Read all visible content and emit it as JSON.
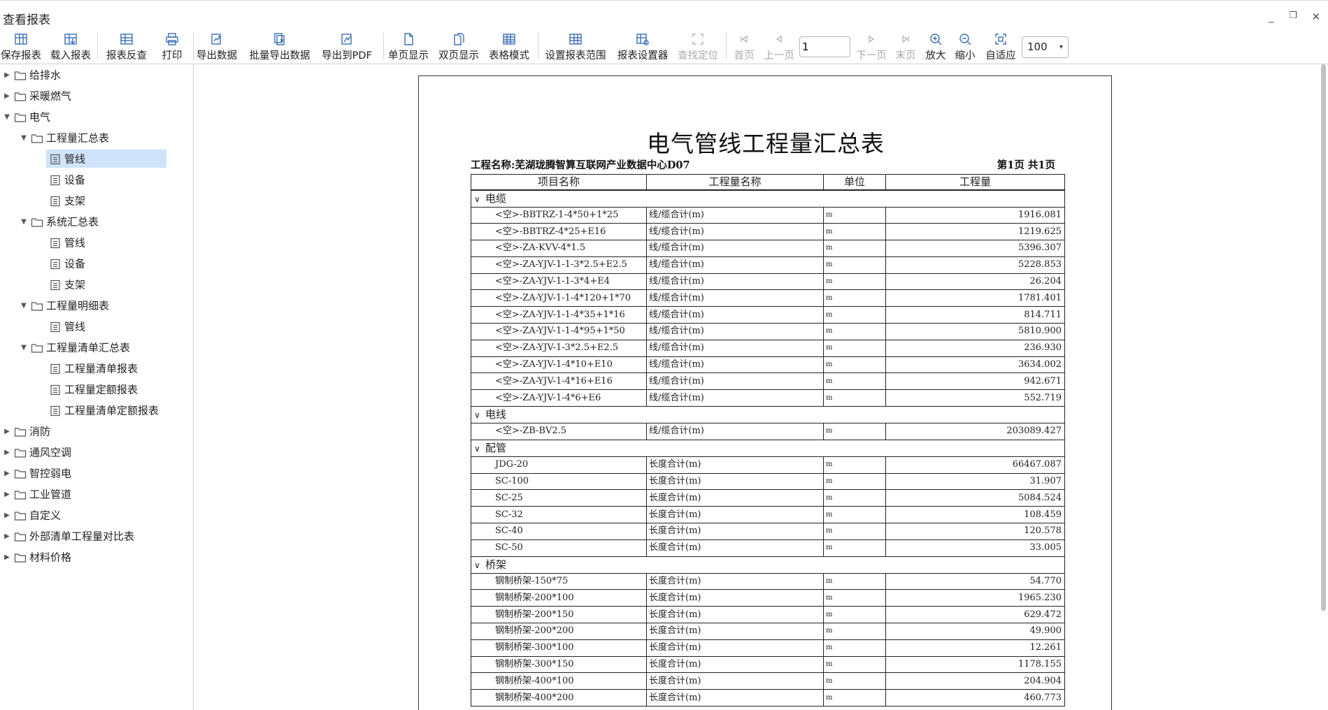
{
  "window": {
    "title": "查看报表",
    "controls": {
      "minimize": "_",
      "restore": "❐",
      "close": "✕"
    }
  },
  "toolbar": {
    "buttons": [
      {
        "label": "保存报表",
        "icon": "save-report-icon",
        "enabled": true
      },
      {
        "label": "载入报表",
        "icon": "load-report-icon",
        "enabled": true
      },
      {
        "label": "报表反查",
        "icon": "report-reverse-lookup-icon",
        "enabled": true
      },
      {
        "label": "打印",
        "icon": "printer-icon",
        "enabled": true
      },
      {
        "label": "导出数据",
        "icon": "export-data-icon",
        "enabled": true
      },
      {
        "label": "批量导出数据",
        "icon": "batch-export-icon",
        "enabled": true
      },
      {
        "label": "导出到PDF",
        "icon": "export-pdf-icon",
        "enabled": true
      },
      {
        "label": "单页显示",
        "icon": "single-page-icon",
        "enabled": true
      },
      {
        "label": "双页显示",
        "icon": "double-page-icon",
        "enabled": true
      },
      {
        "label": "表格模式",
        "icon": "table-mode-icon",
        "enabled": true
      },
      {
        "label": "设置报表范围",
        "icon": "report-range-icon",
        "enabled": true
      },
      {
        "label": "报表设置器",
        "icon": "report-settings-icon",
        "enabled": true
      },
      {
        "label": "查找定位",
        "icon": "locate-icon",
        "enabled": false
      },
      {
        "label": "首页",
        "icon": "first-page-icon",
        "enabled": false
      },
      {
        "label": "上一页",
        "icon": "prev-page-icon",
        "enabled": false
      },
      {
        "label": "下一页",
        "icon": "next-page-icon",
        "enabled": false
      },
      {
        "label": "末页",
        "icon": "last-page-icon",
        "enabled": false
      },
      {
        "label": "放大",
        "icon": "zoom-in-icon",
        "enabled": true
      },
      {
        "label": "缩小",
        "icon": "zoom-out-icon",
        "enabled": true
      },
      {
        "label": "自适应",
        "icon": "fit-icon",
        "enabled": true
      }
    ],
    "page_input_value": "1",
    "zoom_value": "100"
  },
  "tree": [
    {
      "label": "给排水",
      "type": "folder",
      "expanded": false,
      "level": 0
    },
    {
      "label": "采暖燃气",
      "type": "folder",
      "expanded": false,
      "level": 0
    },
    {
      "label": "电气",
      "type": "folder",
      "expanded": true,
      "level": 0
    },
    {
      "label": "工程量汇总表",
      "type": "folder",
      "expanded": true,
      "level": 1
    },
    {
      "label": "管线",
      "type": "report",
      "level": 2,
      "selected": true
    },
    {
      "label": "设备",
      "type": "report",
      "level": 2
    },
    {
      "label": "支架",
      "type": "report",
      "level": 2
    },
    {
      "label": "系统汇总表",
      "type": "folder",
      "expanded": true,
      "level": 1
    },
    {
      "label": "管线",
      "type": "report",
      "level": 2
    },
    {
      "label": "设备",
      "type": "report",
      "level": 2
    },
    {
      "label": "支架",
      "type": "report",
      "level": 2
    },
    {
      "label": "工程量明细表",
      "type": "folder",
      "expanded": true,
      "level": 1
    },
    {
      "label": "管线",
      "type": "report",
      "level": 2
    },
    {
      "label": "工程量清单汇总表",
      "type": "folder",
      "expanded": true,
      "level": 1
    },
    {
      "label": "工程量清单报表",
      "type": "report",
      "level": 2
    },
    {
      "label": "工程量定额报表",
      "type": "report",
      "level": 2
    },
    {
      "label": "工程量清单定额报表",
      "type": "report",
      "level": 2
    },
    {
      "label": "消防",
      "type": "folder",
      "expanded": false,
      "level": 0
    },
    {
      "label": "通风空调",
      "type": "folder",
      "expanded": false,
      "level": 0
    },
    {
      "label": "智控弱电",
      "type": "folder",
      "expanded": false,
      "level": 0
    },
    {
      "label": "工业管道",
      "type": "folder",
      "expanded": false,
      "level": 0
    },
    {
      "label": "自定义",
      "type": "folder",
      "expanded": false,
      "level": 0
    },
    {
      "label": "外部清单工程量对比表",
      "type": "folder",
      "expanded": false,
      "level": 0
    },
    {
      "label": "材料价格",
      "type": "folder",
      "expanded": false,
      "level": 0
    }
  ],
  "report": {
    "title": "电气管线工程量汇总表",
    "project_label": "工程名称:芜湖珑腾智算互联网产业数据中心D07",
    "page_info": "第1页 共1页",
    "columns": [
      "项目名称",
      "工程量名称",
      "单位",
      "工程量"
    ],
    "rows": [
      {
        "group": "电缆"
      },
      {
        "name": "<空>-BBTRZ-1-4*50+1*25",
        "qty_name": "线/缆合计(m)",
        "unit": "m",
        "qty": "1916.081"
      },
      {
        "name": "<空>-BBTRZ-4*25+E16",
        "qty_name": "线/缆合计(m)",
        "unit": "m",
        "qty": "1219.625"
      },
      {
        "name": "<空>-ZA-KVV-4*1.5",
        "qty_name": "线/缆合计(m)",
        "unit": "m",
        "qty": "5396.307"
      },
      {
        "name": "<空>-ZA-YJV-1-1-3*2.5+E2.5",
        "qty_name": "线/缆合计(m)",
        "unit": "m",
        "qty": "5228.853"
      },
      {
        "name": "<空>-ZA-YJV-1-1-3*4+E4",
        "qty_name": "线/缆合计(m)",
        "unit": "m",
        "qty": "26.204"
      },
      {
        "name": "<空>-ZA-YJV-1-1-4*120+1*70",
        "qty_name": "线/缆合计(m)",
        "unit": "m",
        "qty": "1781.401"
      },
      {
        "name": "<空>-ZA-YJV-1-1-4*35+1*16",
        "qty_name": "线/缆合计(m)",
        "unit": "m",
        "qty": "814.711"
      },
      {
        "name": "<空>-ZA-YJV-1-1-4*95+1*50",
        "qty_name": "线/缆合计(m)",
        "unit": "m",
        "qty": "5810.900"
      },
      {
        "name": "<空>-ZA-YJV-1-3*2.5+E2.5",
        "qty_name": "线/缆合计(m)",
        "unit": "m",
        "qty": "236.930"
      },
      {
        "name": "<空>-ZA-YJV-1-4*10+E10",
        "qty_name": "线/缆合计(m)",
        "unit": "m",
        "qty": "3634.002"
      },
      {
        "name": "<空>-ZA-YJV-1-4*16+E16",
        "qty_name": "线/缆合计(m)",
        "unit": "m",
        "qty": "942.671"
      },
      {
        "name": "<空>-ZA-YJV-1-4*6+E6",
        "qty_name": "线/缆合计(m)",
        "unit": "m",
        "qty": "552.719"
      },
      {
        "group": "电线"
      },
      {
        "name": "<空>-ZB-BV2.5",
        "qty_name": "线/缆合计(m)",
        "unit": "m",
        "qty": "203089.427"
      },
      {
        "group": "配管"
      },
      {
        "name": "JDG-20",
        "qty_name": "长度合计(m)",
        "unit": "m",
        "qty": "66467.087"
      },
      {
        "name": "SC-100",
        "qty_name": "长度合计(m)",
        "unit": "m",
        "qty": "31.907"
      },
      {
        "name": "SC-25",
        "qty_name": "长度合计(m)",
        "unit": "m",
        "qty": "5084.524"
      },
      {
        "name": "SC-32",
        "qty_name": "长度合计(m)",
        "unit": "m",
        "qty": "108.459"
      },
      {
        "name": "SC-40",
        "qty_name": "长度合计(m)",
        "unit": "m",
        "qty": "120.578"
      },
      {
        "name": "SC-50",
        "qty_name": "长度合计(m)",
        "unit": "m",
        "qty": "33.005"
      },
      {
        "group": "桥架"
      },
      {
        "name": "钢制桥架-150*75",
        "qty_name": "长度合计(m)",
        "unit": "m",
        "qty": "54.770"
      },
      {
        "name": "钢制桥架-200*100",
        "qty_name": "长度合计(m)",
        "unit": "m",
        "qty": "1965.230"
      },
      {
        "name": "钢制桥架-200*150",
        "qty_name": "长度合计(m)",
        "unit": "m",
        "qty": "629.472"
      },
      {
        "name": "钢制桥架-200*200",
        "qty_name": "长度合计(m)",
        "unit": "m",
        "qty": "49.900"
      },
      {
        "name": "钢制桥架-300*100",
        "qty_name": "长度合计(m)",
        "unit": "m",
        "qty": "12.261"
      },
      {
        "name": "钢制桥架-300*150",
        "qty_name": "长度合计(m)",
        "unit": "m",
        "qty": "1178.155"
      },
      {
        "name": "钢制桥架-400*100",
        "qty_name": "长度合计(m)",
        "unit": "m",
        "qty": "204.904"
      },
      {
        "name": "钢制桥架-400*200",
        "qty_name": "长度合计(m)",
        "unit": "m",
        "qty": "460.773"
      }
    ]
  },
  "colors": {
    "selection": "#cfe3fb",
    "accent_icon": "#3b6fb6",
    "disabled_icon": "#b5b5b5",
    "splitter_marker": "#6ec15d"
  }
}
